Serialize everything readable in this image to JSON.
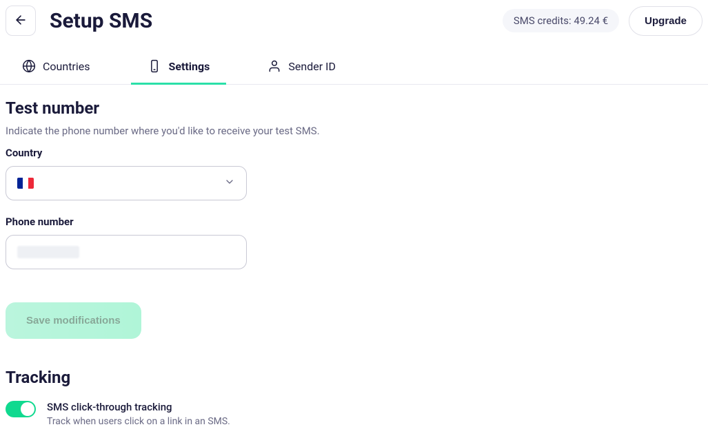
{
  "header": {
    "title": "Setup SMS",
    "credits_label": "SMS credits: 49.24 €",
    "upgrade_label": "Upgrade"
  },
  "tabs": [
    {
      "label": "Countries",
      "icon": "globe-icon",
      "active": false
    },
    {
      "label": "Settings",
      "icon": "phone-icon",
      "active": true
    },
    {
      "label": "Sender ID",
      "icon": "user-icon",
      "active": false
    }
  ],
  "test_number": {
    "title": "Test number",
    "subtitle": "Indicate the phone number where you'd like to receive your test SMS.",
    "country_label": "Country",
    "country_value": "France",
    "flag_colors": [
      "#002395",
      "#ffffff",
      "#ed2939"
    ],
    "phone_label": "Phone number",
    "phone_value": "",
    "save_label": "Save modifications"
  },
  "tracking": {
    "title": "Tracking",
    "toggle_on": true,
    "toggle_label": "SMS click-through tracking",
    "toggle_desc": "Track when users click on a link in an SMS."
  }
}
